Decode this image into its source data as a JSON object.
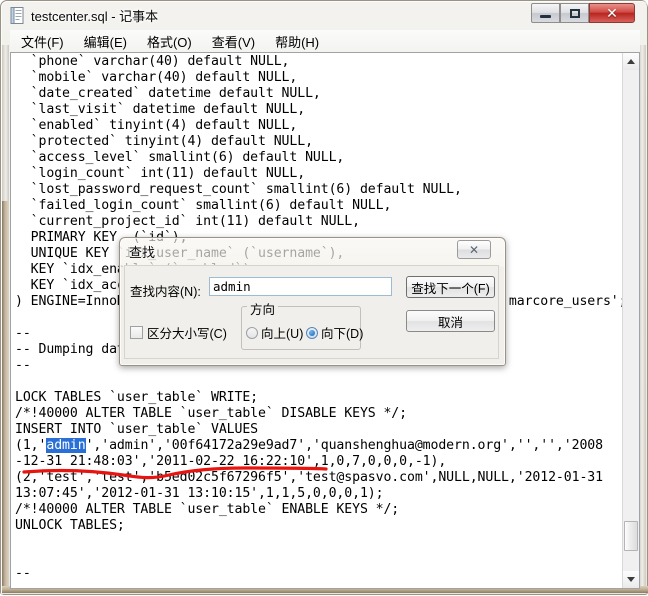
{
  "window": {
    "title": "testcenter.sql - 记事本",
    "icon": "notepad-icon",
    "buttons": {
      "minimize": "最小化",
      "maximize": "最大化",
      "close": "✕"
    }
  },
  "menu": {
    "items": [
      {
        "label": "文件(F)",
        "text": "文件",
        "accel": "F"
      },
      {
        "label": "编辑(E)",
        "text": "编辑",
        "accel": "E"
      },
      {
        "label": "格式(O)",
        "text": "格式",
        "accel": "O"
      },
      {
        "label": "查看(V)",
        "text": "查看",
        "accel": "V"
      },
      {
        "label": "帮助(H)",
        "text": "帮助",
        "accel": "H"
      }
    ]
  },
  "editor": {
    "lines_before_selection": "  `phone` varchar(40) default NULL,\n  `mobile` varchar(40) default NULL,\n  `date_created` datetime default NULL,\n  `last_visit` datetime default NULL,\n  `enabled` tinyint(4) default NULL,\n  `protected` tinyint(4) default NULL,\n  `access_level` smallint(6) default NULL,\n  `login_count` int(11) default NULL,\n  `lost_password_request_count` smallint(6) default NULL,\n  `failed_login_count` smallint(6) default NULL,\n  `current_project_id` int(11) default NULL,\n  PRIMARY KEY  (`id`),\n  UNIQUE KEY `idx_user_name` (`username`),\n  KEY `idx_enable` (`enabled`),\n  KEY `idx_access_level` (`access_level`)\n) ENGINE=InnoDB AUTO_INCREMENT=3 DEFAULT CHARSET=utf8 COMMENT='marcore_users';\n\n--\n-- Dumping data for table `user_table`\n--\n\nLOCK TABLES `user_table` WRITE;\n/*!40000 ALTER TABLE `user_table` DISABLE KEYS */;\nINSERT INTO `user_table` VALUES\n(1,'",
    "selected_text": "admin",
    "lines_after_selection": "','admin','00f64172a29e9ad7','quanshenghua@modern.org','','','2008\n-12-31 21:48:03','2011-02-22 16:22:10',1,0,7,0,0,0,-1),\n(2,'test','test','b5ed02c5f67296f5','test@spasvo.com',NULL,NULL,'2012-01-31\n13:07:45','2012-01-31 13:10:15',1,1,5,0,0,0,1);\n/*!40000 ALTER TABLE `user_table` ENABLE KEYS */;\nUNLOCK TABLES;\n\n\n--",
    "scrollbar": {
      "up_arrow": "▲",
      "down_arrow": "▼"
    }
  },
  "find_dialog": {
    "title": "查找",
    "close_label": "✕",
    "search_label": "查找内容(N):",
    "search_value": "admin",
    "search_placeholder": "",
    "find_next_label": "查找下一个(F)",
    "cancel_label": "取消",
    "match_case_label": "区分大小写(C)",
    "match_case_checked": false,
    "direction_group_label": "方向",
    "direction_up_label": "向上(U)",
    "direction_down_label": "向下(D)",
    "direction_selected": "down"
  },
  "annotation": {
    "type": "hand-drawn-underline",
    "color": "#e8140f",
    "target": "admin record row"
  },
  "colors": {
    "selection_blue": "#2a6fd6",
    "annotation_red": "#e8140f",
    "close_button_red": "#b8251f"
  }
}
